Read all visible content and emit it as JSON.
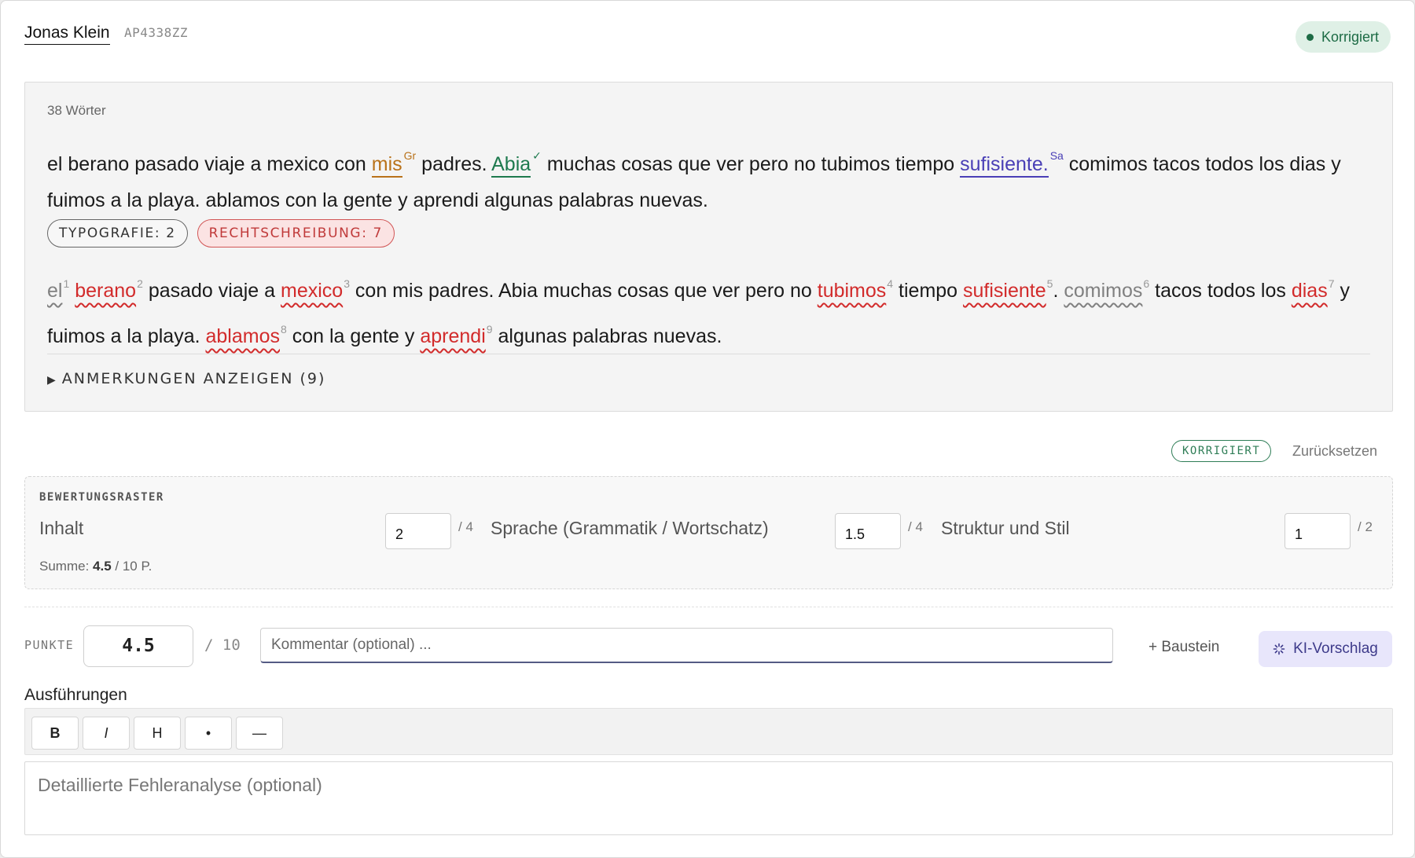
{
  "header": {
    "student_name": "Jonas Klein",
    "student_id": "AP4338ZZ",
    "status": "Korrigiert"
  },
  "essay": {
    "word_count": "38 Wörter",
    "original": {
      "t1": "el berano pasado viaje a mexico con ",
      "mark1": "mis",
      "mark1_tag": "Gr",
      "t2": " padres. ",
      "mark2": "Abia",
      "mark2_tag": "✓",
      "t3": " muchas cosas que ver pero no tubimos tiempo ",
      "mark3": "sufisiente.",
      "mark3_tag": "Sa",
      "t4": " comimos tacos todos los dias y fuimos a la playa. ablamos con la gente y aprendi algunas palabras nuevas."
    },
    "chips": {
      "typography": "TYPOGRAFIE: 2",
      "spelling": "RECHTSCHREIBUNG: 7"
    },
    "corrected": {
      "w1": "el",
      "n1": "1",
      "w2": "berano",
      "n2": "2",
      "t2": " pasado viaje a ",
      "w3": "mexico",
      "n3": "3",
      "t3": " con mis padres. Abia muchas cosas que ver pero no ",
      "w4": "tubimos",
      "n4": "4",
      "t4": " tiempo ",
      "w5": "sufisiente",
      "n5": "5",
      "t5": ". ",
      "w6": "comimos",
      "n6": "6",
      "t6": " tacos todos los ",
      "w7": "dias",
      "n7": "7",
      "t7": " y fuimos a la playa. ",
      "w8": "ablamos",
      "n8": "8",
      "t8": " con la gente y ",
      "w9": "aprendi",
      "n9": "9",
      "t9": " algunas palabras nuevas."
    },
    "notes_toggle": "ANMERKUNGEN ANZEIGEN (9)"
  },
  "grading": {
    "badge": "KORRIGIERT",
    "reset": "Zurücksetzen"
  },
  "rubric": {
    "title": "BEWERTUNGSRASTER",
    "criteria": [
      {
        "label": "Inhalt",
        "value": "2",
        "max": "/ 4"
      },
      {
        "label": "Sprache (Grammatik / Wortschatz)",
        "value": "1.5",
        "max": "/ 4"
      },
      {
        "label": "Struktur und Stil",
        "value": "1",
        "max": "/ 2"
      }
    ],
    "sum_prefix": "Summe: ",
    "sum_value": "4.5",
    "sum_suffix": " / 10 P."
  },
  "points": {
    "label": "PUNKTE",
    "value": "4.5",
    "max": "/ 10",
    "comment_placeholder": "Kommentar (optional) ...",
    "baustein": "+ Baustein",
    "ki": "KI-Vorschlag"
  },
  "details": {
    "label": "Ausführungen",
    "toolbar": [
      "B",
      "I",
      "H",
      "•",
      "—"
    ],
    "placeholder": "Detaillierte Fehleranalyse (optional)"
  },
  "colors": {
    "status_bg": "#dff0e6",
    "status_fg": "#1d6b45",
    "grammar": "#b9721a",
    "ok": "#1e7a4e",
    "syntax": "#4a3fb6",
    "spelling_error": "#d22b2b",
    "typography_error": "#808080",
    "ki_bg": "#e8e6fb"
  }
}
